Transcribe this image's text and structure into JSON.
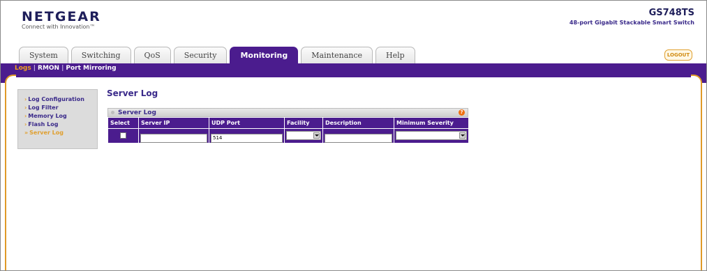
{
  "header": {
    "brand": "NETGEAR",
    "tagline": "Connect with Innovation",
    "model": "GS748TS",
    "model_desc": "48-port Gigabit Stackable Smart Switch"
  },
  "tabs": [
    {
      "label": "System"
    },
    {
      "label": "Switching"
    },
    {
      "label": "QoS"
    },
    {
      "label": "Security"
    },
    {
      "label": "Monitoring",
      "active": true
    },
    {
      "label": "Maintenance"
    },
    {
      "label": "Help"
    }
  ],
  "logout_label": "LOGOUT",
  "subnav": [
    {
      "label": "Logs",
      "active": true
    },
    {
      "label": "RMON"
    },
    {
      "label": "Port Mirroring"
    }
  ],
  "leftmenu": [
    {
      "label": "Log Configuration"
    },
    {
      "label": "Log Filter"
    },
    {
      "label": "Memory Log"
    },
    {
      "label": "Flash Log"
    },
    {
      "label": "Server Log",
      "active": true
    }
  ],
  "page_title": "Server Log",
  "panel": {
    "title": "Server Log",
    "help_glyph": "?",
    "columns": [
      "Select",
      "Server IP",
      "UDP Port",
      "Facility",
      "Description",
      "Minimum Severity"
    ],
    "row": {
      "server_ip": "",
      "udp_port": "514",
      "facility": "",
      "description": "",
      "minimum_severity": ""
    }
  },
  "colors": {
    "purple": "#4b1c8e",
    "orange": "#e0a030",
    "navy": "#1e1e5a"
  }
}
